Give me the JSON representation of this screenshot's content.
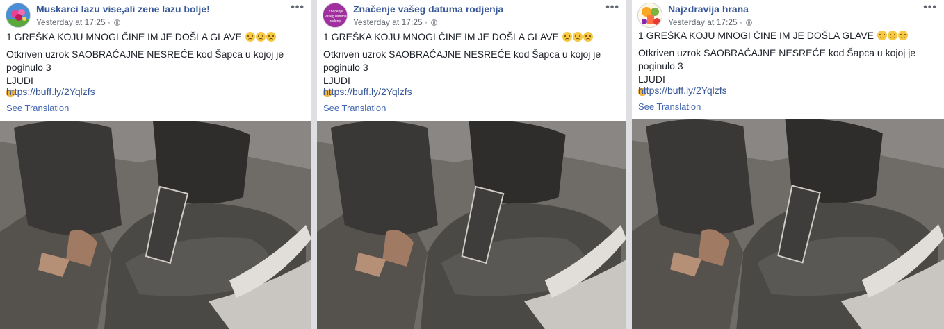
{
  "posts": [
    {
      "page_name": "Muskarci lazu vise,ali zene lazu bolje!",
      "time": "Yesterday at 17:25",
      "separator": "·",
      "headline": "1 GREŠKA KOJU MNOGI ČINE IM JE DOŠLA GLAVE",
      "body": "Otkriven uzrok SAOBRAĆAJNE NESREĆE kod Šapca u kojoj je poginulo 3",
      "body_line2": "LJUDI",
      "link": "https://buff.ly/2Yqlzfs",
      "see_translation": "See Translation",
      "avatar_icon": "flower-avatar-icon",
      "photo_icon": "car-interior-photo"
    },
    {
      "page_name": "Značenje vašeg datuma rodjenja",
      "time": "Yesterday at 17:25",
      "separator": "·",
      "headline": "1 GREŠKA KOJU MNOGI ČINE IM JE DOŠLA GLAVE",
      "body": "Otkriven uzrok SAOBRAĆAJNE NESREĆE kod Šapca u kojoj je poginulo 3",
      "body_line2": "LJUDI",
      "link": "https://buff.ly/2Yqlzfs",
      "see_translation": "See Translation",
      "avatar_icon": "purple-text-avatar-icon",
      "avatar_text": "Značenje vašeg datuma rođenja",
      "photo_icon": "car-interior-photo"
    },
    {
      "page_name": "Najzdravija hrana",
      "time": "Yesterday at 17:25",
      "separator": "·",
      "headline": "1 GREŠKA KOJU MNOGI ČINE IM JE DOŠLA GLAVE",
      "body": "Otkriven uzrok SAOBRAĆAJNE NESREĆE kod Šapca u kojoj je poginulo 3",
      "body_line2": "LJUDI",
      "link": "https://buff.ly/2Yqlzfs",
      "see_translation": "See Translation",
      "avatar_icon": "fruit-juice-avatar-icon",
      "photo_icon": "car-interior-photo"
    }
  ],
  "more_label": "•••",
  "colors": {
    "page_name": "#385898",
    "link": "#385898",
    "translate": "#4267b2",
    "text": "#1d2129",
    "meta": "#616770",
    "background": "#dddfe2"
  }
}
